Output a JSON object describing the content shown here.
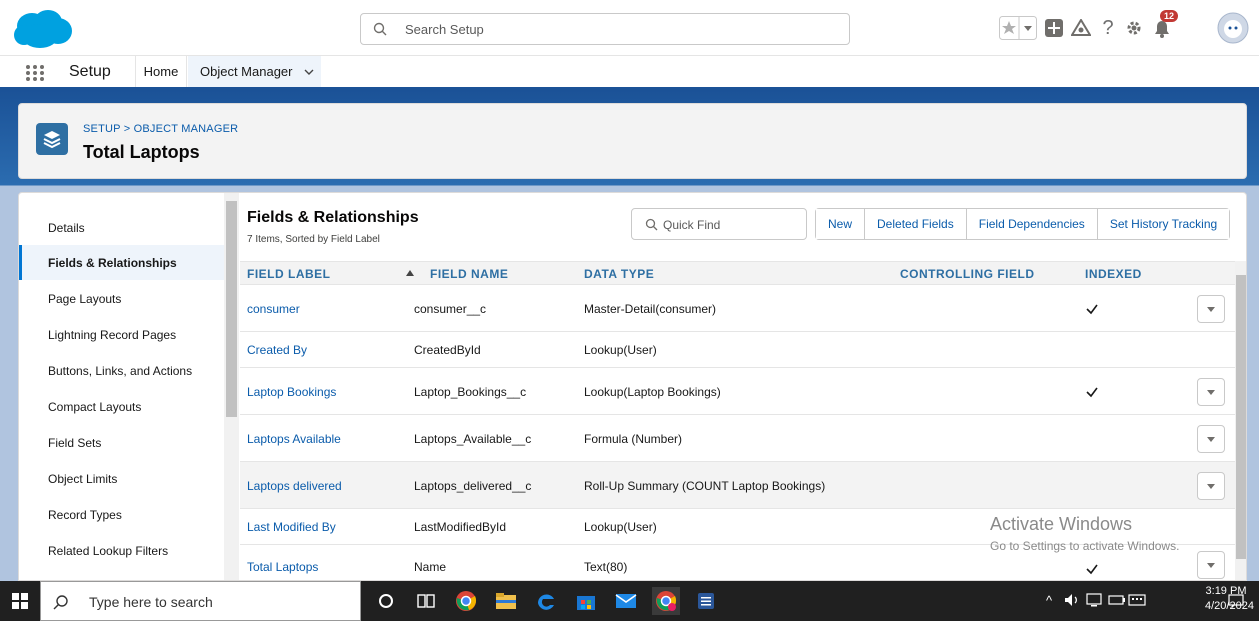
{
  "header": {
    "search_placeholder": "Search Setup",
    "notification_count": "12"
  },
  "app_nav": {
    "app_name": "Setup",
    "tabs": [
      {
        "label": "Home"
      },
      {
        "label": "Object Manager"
      }
    ]
  },
  "page_header": {
    "breadcrumb": "SETUP > OBJECT MANAGER",
    "title": "Total Laptops"
  },
  "sidenav": {
    "items": [
      {
        "label": "Details"
      },
      {
        "label": "Fields & Relationships"
      },
      {
        "label": "Page Layouts"
      },
      {
        "label": "Lightning Record Pages"
      },
      {
        "label": "Buttons, Links, and Actions"
      },
      {
        "label": "Compact Layouts"
      },
      {
        "label": "Field Sets"
      },
      {
        "label": "Object Limits"
      },
      {
        "label": "Record Types"
      },
      {
        "label": "Related Lookup Filters"
      }
    ]
  },
  "fields": {
    "title": "Fields & Relationships",
    "subtitle": "7 Items, Sorted by Field Label",
    "quick_find_placeholder": "Quick Find",
    "buttons": [
      "New",
      "Deleted Fields",
      "Field Dependencies",
      "Set History Tracking"
    ],
    "columns": [
      "FIELD LABEL",
      "FIELD NAME",
      "DATA TYPE",
      "CONTROLLING FIELD",
      "INDEXED"
    ],
    "rows": [
      {
        "label": "consumer",
        "name": "consumer__c",
        "type": "Master-Detail(consumer)",
        "controlling": "",
        "indexed": true,
        "menu": true
      },
      {
        "label": "Created By",
        "name": "CreatedById",
        "type": "Lookup(User)",
        "controlling": "",
        "indexed": false,
        "menu": false
      },
      {
        "label": "Laptop Bookings",
        "name": "Laptop_Bookings__c",
        "type": "Lookup(Laptop Bookings)",
        "controlling": "",
        "indexed": true,
        "menu": true
      },
      {
        "label": "Laptops Available",
        "name": "Laptops_Available__c",
        "type": "Formula (Number)",
        "controlling": "",
        "indexed": false,
        "menu": true
      },
      {
        "label": "Laptops delivered",
        "name": "Laptops_delivered__c",
        "type": "Roll-Up Summary (COUNT Laptop Bookings)",
        "controlling": "",
        "indexed": false,
        "menu": true
      },
      {
        "label": "Last Modified By",
        "name": "LastModifiedById",
        "type": "Lookup(User)",
        "controlling": "",
        "indexed": false,
        "menu": false
      },
      {
        "label": "Total Laptops",
        "name": "Name",
        "type": "Text(80)",
        "controlling": "",
        "indexed": true,
        "menu": true
      }
    ]
  },
  "watermark": {
    "line1": "Activate Windows",
    "line2": "Go to Settings to activate Windows."
  },
  "taskbar": {
    "search_placeholder": "Type here to search",
    "time": "3:19 PM",
    "date": "4/20/2024"
  },
  "colors": {
    "brand_blue": "#1b5297",
    "link_blue": "#0b5cab",
    "header_blue": "#2e6fa3"
  }
}
